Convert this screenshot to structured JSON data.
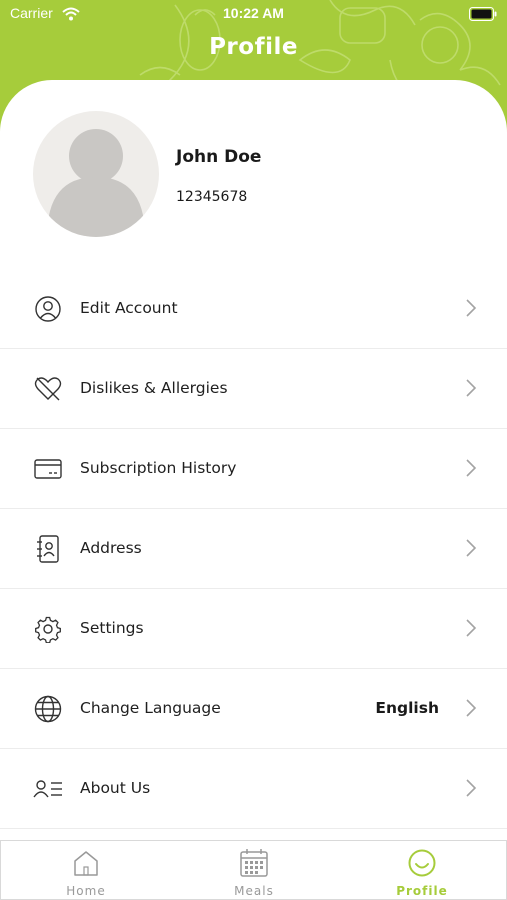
{
  "status_bar": {
    "carrier": "Carrier",
    "time": "10:22 AM"
  },
  "header": {
    "title": "Profile",
    "accent_color": "#a6cc3b"
  },
  "profile": {
    "name": "John Doe",
    "phone": "12345678"
  },
  "menu": [
    {
      "label": "Edit Account",
      "icon": "user-circle-icon"
    },
    {
      "label": "Dislikes & Allergies",
      "icon": "heart-slash-icon"
    },
    {
      "label": "Subscription History",
      "icon": "card-icon"
    },
    {
      "label": "Address",
      "icon": "address-book-icon"
    },
    {
      "label": "Settings",
      "icon": "gear-icon"
    },
    {
      "label": "Change Language",
      "icon": "globe-icon",
      "value": "English"
    },
    {
      "label": "About Us",
      "icon": "about-icon"
    }
  ],
  "tabbar": [
    {
      "label": "Home",
      "icon": "home-icon",
      "active": false
    },
    {
      "label": "Meals",
      "icon": "calendar-icon",
      "active": false
    },
    {
      "label": "Profile",
      "icon": "smiley-icon",
      "active": true
    }
  ]
}
